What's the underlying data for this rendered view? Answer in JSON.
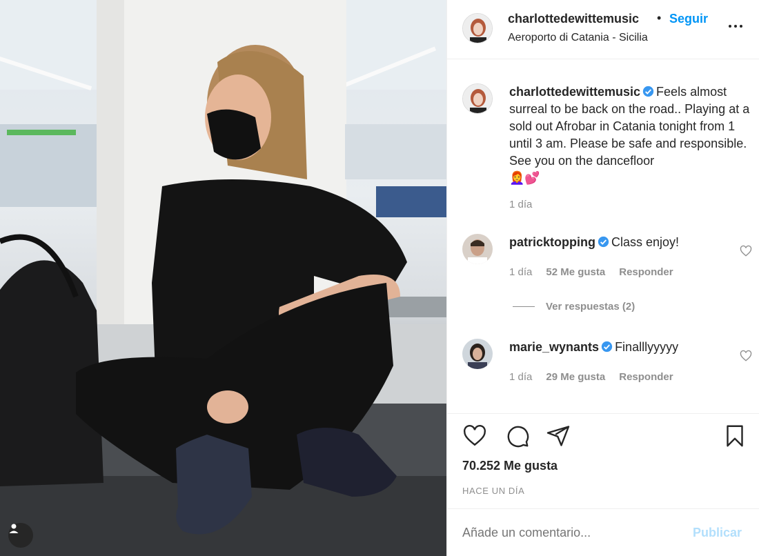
{
  "post": {
    "username": "charlottedewittemusic",
    "follow_label": "Seguir",
    "location": "Aeroporto di Catania - Sicilia",
    "caption": {
      "username": "charlottedewittemusic",
      "text": "Feels almost surreal to be back on the road.. Playing at a sold out Afrobar in Catania tonight from 1 until 3 am. Please be safe and responsible. See you on the dancefloor",
      "emoji": "👩‍🦰💕",
      "time": "1 día"
    },
    "comments": [
      {
        "username": "patricktopping",
        "text": "Class enjoy!",
        "time": "1 día",
        "likes": "52 Me gusta",
        "reply_label": "Responder",
        "view_replies": "Ver respuestas (2)"
      },
      {
        "username": "marie_wynants",
        "text": "Finalllyyyyy",
        "time": "1 día",
        "likes": "29 Me gusta",
        "reply_label": "Responder"
      }
    ],
    "like_count": "70.252 Me gusta",
    "posted_ago": "HACE UN DÍA",
    "comment_placeholder": "Añade un comentario...",
    "publish_label": "Publicar"
  },
  "icons": {
    "like": "heart-icon",
    "comment": "comment-icon",
    "share": "share-icon",
    "save": "bookmark-icon",
    "options": "more-options-icon",
    "verified": "verified-badge-icon",
    "user_tag": "user-tag-icon"
  },
  "colors": {
    "accent": "#0095f6",
    "verified": "#3897f0",
    "muted": "#8e8e8e",
    "publish_disabled": "#b2dffc"
  }
}
